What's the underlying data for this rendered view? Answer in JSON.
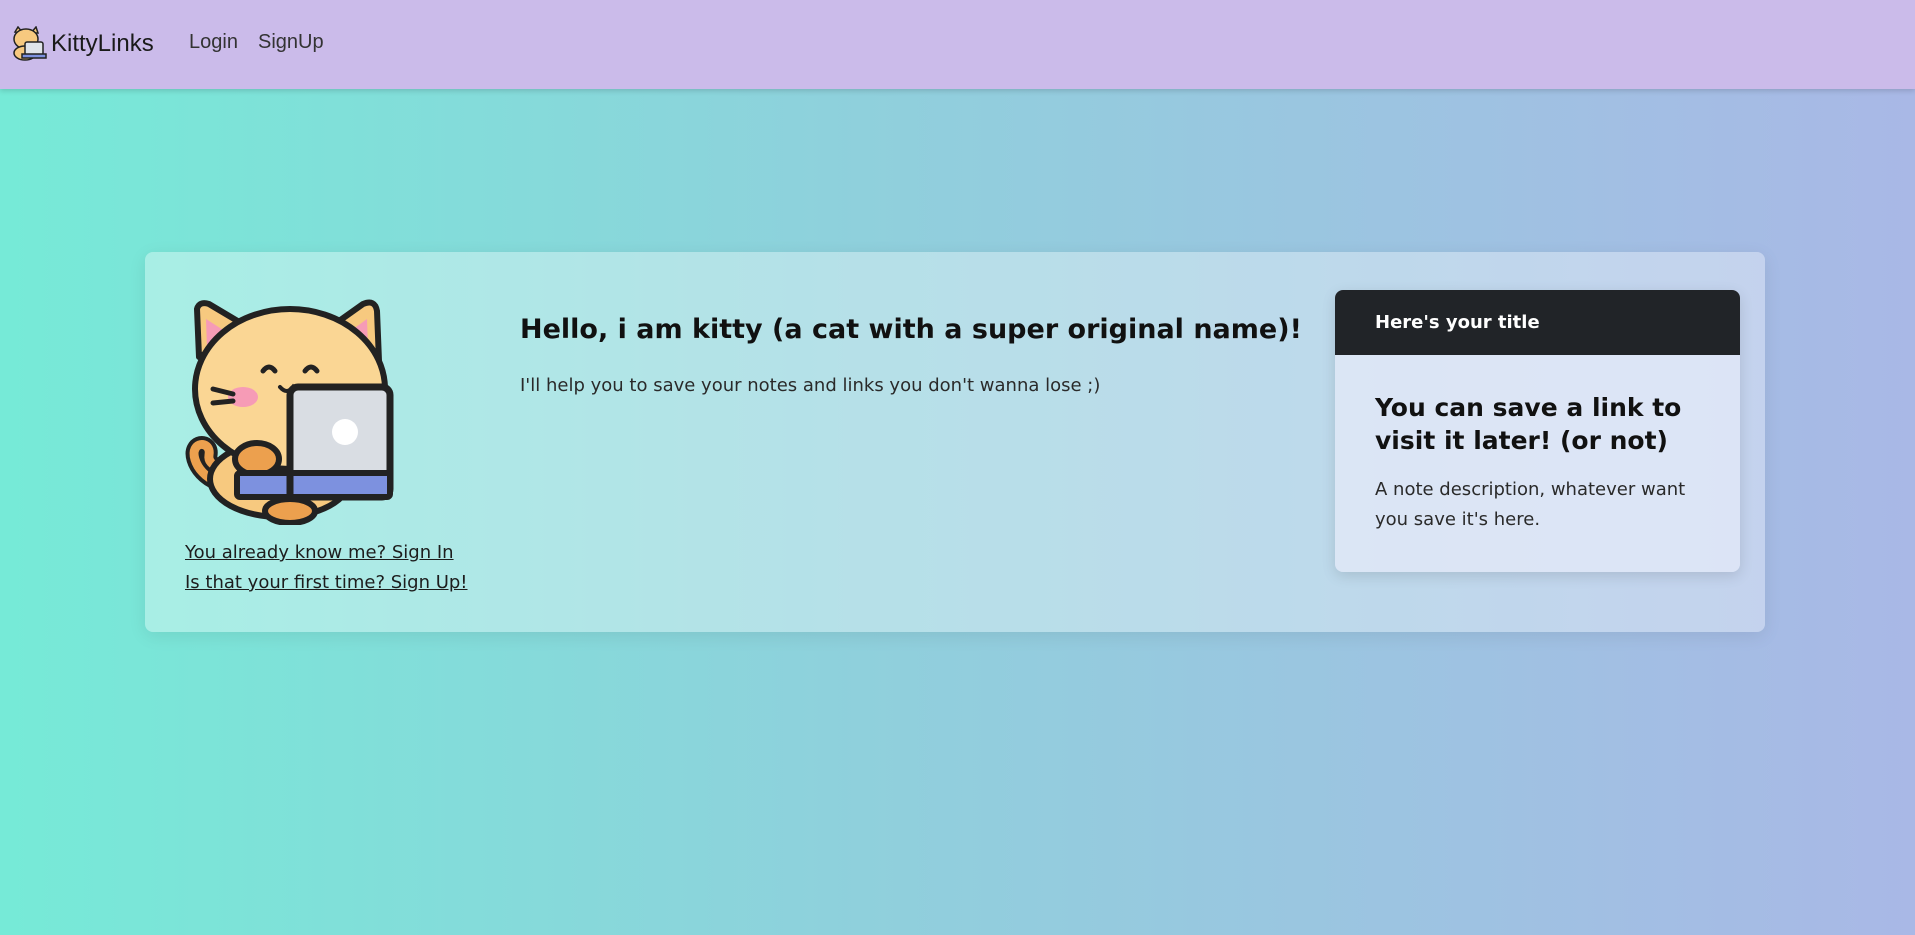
{
  "navbar": {
    "brand": "KittyLinks",
    "logo_icon": "cat-laptop-icon",
    "links": [
      "Login",
      "SignUp"
    ]
  },
  "hero": {
    "title": "Hello, i am kitty (a cat with a super original name)!",
    "lead": "I'll help you to save your notes and links you don't wanna lose ;)",
    "illustration_icon": "cat-with-laptop-illustration",
    "signin_link": "You already know me? Sign In",
    "signup_link": "Is that your first time? Sign Up!"
  },
  "note_card": {
    "header": "Here's your title",
    "title": "You can save a link to visit it later! (or not)",
    "text": "A note description, whatever want you save it's here."
  },
  "colors": {
    "navbar_bg": "#cbbbea",
    "gradient_start": "#76ead7",
    "gradient_end": "#a9b8e6",
    "card_header_bg": "#212428",
    "cat_orange": "#f7c97f",
    "laptop_blue": "#7d91df"
  }
}
